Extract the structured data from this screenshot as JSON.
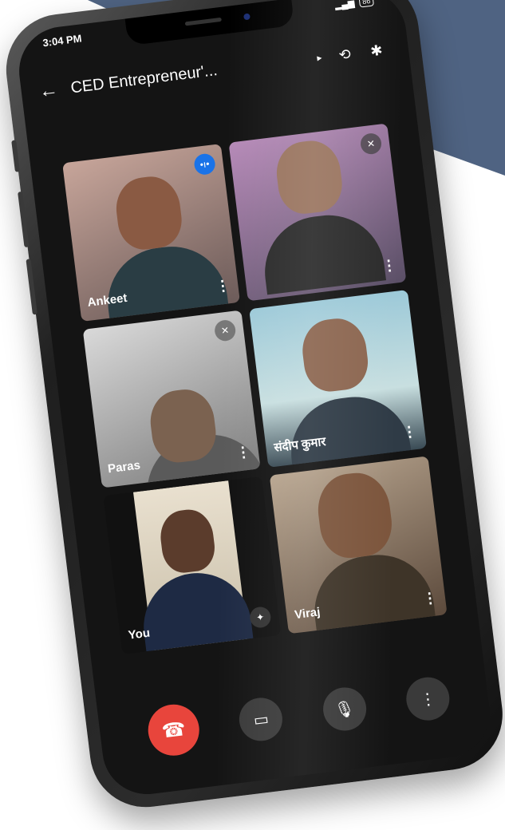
{
  "colors": {
    "background_band": "#4f6382",
    "end_call": "#e8453c",
    "screen_bg": "#141414"
  },
  "status_bar": {
    "time": "3:04 PM",
    "battery": "86"
  },
  "header": {
    "title": "CED Entrepreneur'...",
    "back_icon": "arrow-back-icon",
    "flip_icon": "switch-camera-icon",
    "bt_icon": "bluetooth-icon"
  },
  "participants": [
    {
      "name": "Ankeet",
      "badge": "speaking-icon"
    },
    {
      "name": "",
      "badge": "mic-off-icon"
    },
    {
      "name": "Paras",
      "badge": "mic-off-icon"
    },
    {
      "name": "संदीप कुमार",
      "badge": ""
    },
    {
      "name": "You",
      "badge": "effects-icon"
    },
    {
      "name": "Viraj",
      "badge": ""
    }
  ],
  "controls": {
    "end": "end-call-icon",
    "camera": "camera-icon",
    "mic": "mic-icon",
    "more": "more-vert-icon"
  }
}
